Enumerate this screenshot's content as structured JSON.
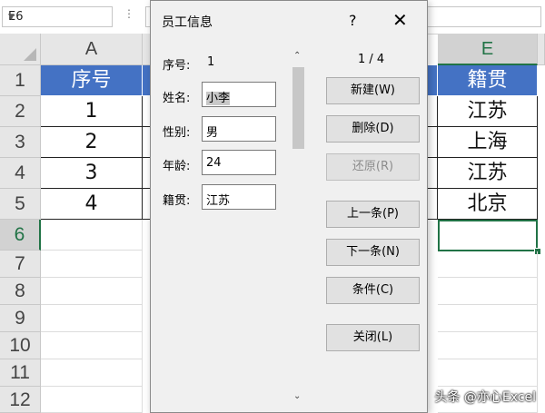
{
  "excel": {
    "name_box": "E6",
    "formula_dots": "⋮",
    "columns": [
      "A",
      "E"
    ],
    "rows": [
      "1",
      "2",
      "3",
      "4",
      "5",
      "6",
      "7",
      "8",
      "9",
      "10",
      "11",
      "12"
    ],
    "colA": {
      "header": "序号",
      "values": [
        "1",
        "2",
        "3",
        "4"
      ]
    },
    "colE": {
      "header": "籍贯",
      "values": [
        "江苏",
        "上海",
        "江苏",
        "北京"
      ]
    },
    "header_color": "#4472c4",
    "selection_color": "#217346"
  },
  "dialog": {
    "title": "员工信息",
    "help": "?",
    "close": "✕",
    "record_label": "序号:",
    "record_value": "1",
    "fields": [
      {
        "label": "姓名:",
        "value": "小李"
      },
      {
        "label": "性别:",
        "value": "男"
      },
      {
        "label": "年龄:",
        "value": "24"
      },
      {
        "label": "籍贯:",
        "value": "江苏"
      }
    ],
    "record_counter": "1 / 4",
    "buttons": {
      "new": "新建(W)",
      "delete": "删除(D)",
      "restore": "还原(R)",
      "prev": "上一条(P)",
      "next": "下一条(N)",
      "criteria": "条件(C)",
      "close": "关闭(L)"
    }
  },
  "watermark": "头条 @亦心Excel"
}
